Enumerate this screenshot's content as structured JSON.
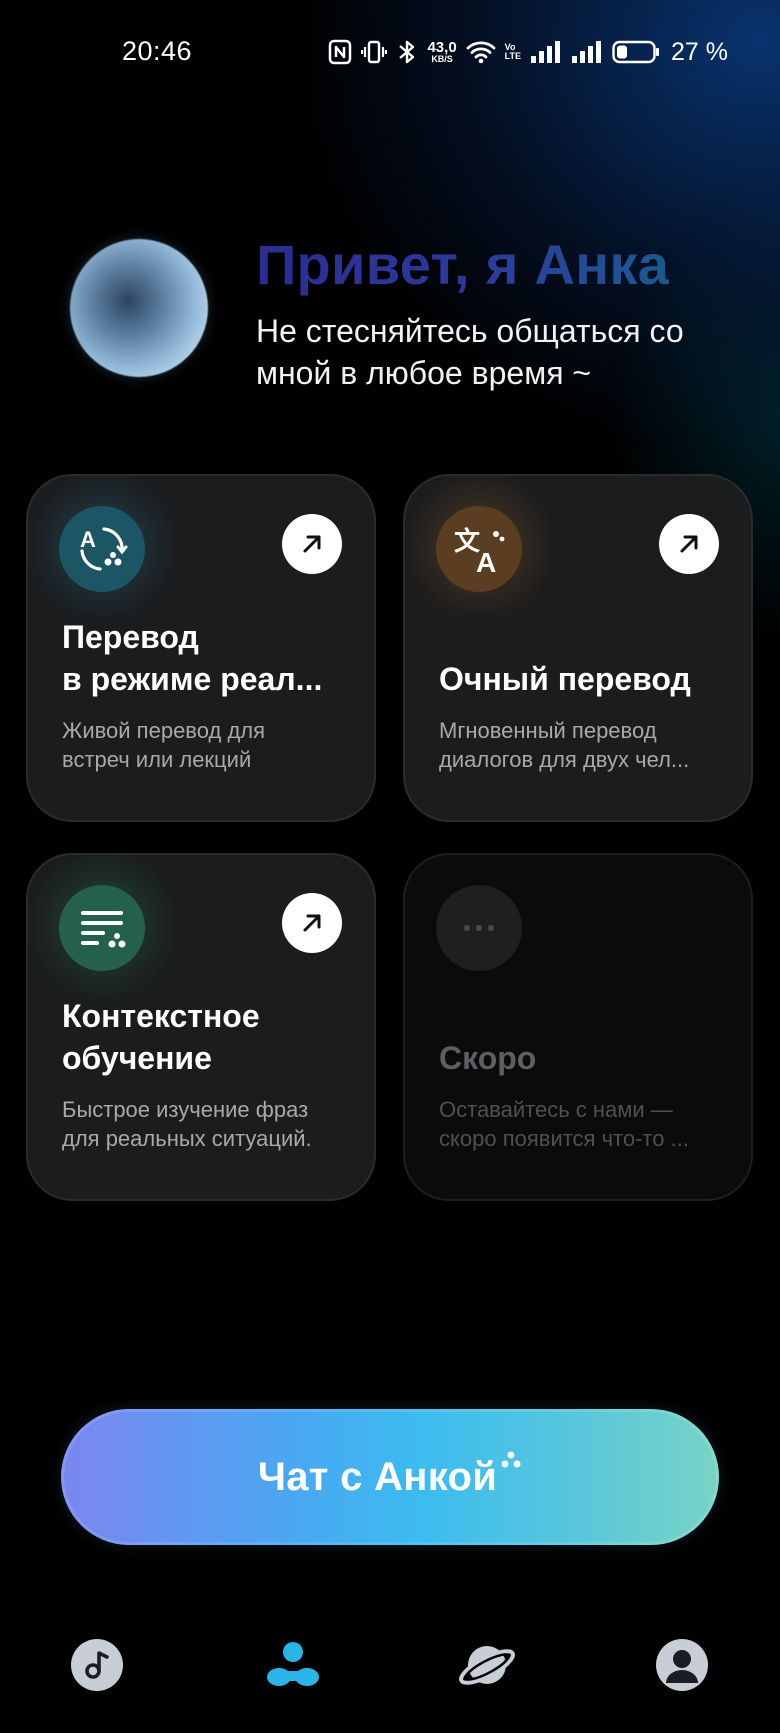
{
  "status_bar": {
    "time": "20:46",
    "net_speed_value": "43,0",
    "net_speed_unit": "KB/S",
    "volte_top": "Vo",
    "volte_bottom": "LTE",
    "battery_percent": "27 %"
  },
  "greeting": {
    "title": "Привет, я Анка",
    "subtitle": "Не стесняйтесь общаться со мной в любое время ~"
  },
  "cards": [
    {
      "title_lines": [
        "Перевод",
        "в режиме реал..."
      ],
      "desc_lines": [
        "Живой перевод для",
        "встреч или лекций"
      ]
    },
    {
      "title_lines": [
        "Очный перевод"
      ],
      "desc_lines": [
        "Мгновенный перевод",
        "диалогов для двух чел..."
      ]
    },
    {
      "title_lines": [
        "Контекстное",
        "обучение"
      ],
      "desc_lines": [
        "Быстрое изучение фраз",
        "для реальных ситуаций."
      ]
    },
    {
      "title_lines": [
        "Скоро"
      ],
      "desc_lines": [
        "Оставайтесь с нами —",
        "скоро появится что-то ..."
      ]
    }
  ],
  "chat_button": {
    "label": "Чат с Анкой"
  },
  "icons": {
    "status": [
      "nfc-icon",
      "vibrate-icon",
      "bluetooth-icon",
      "wifi-icon",
      "signal-icon",
      "battery-icon"
    ],
    "cards": [
      "realtime-translate-icon",
      "translate-icon",
      "context-learning-icon",
      "more-icon"
    ],
    "nav": [
      "music-icon",
      "assistant-icon",
      "planet-icon",
      "profile-icon"
    ]
  },
  "colors": {
    "cta_start": "#7b86f0",
    "cta_mid": "#3cbcf0",
    "cta_end": "#78d4c4",
    "nav_active": "#2ab4e8",
    "nav_inactive": "#c9ced6"
  }
}
